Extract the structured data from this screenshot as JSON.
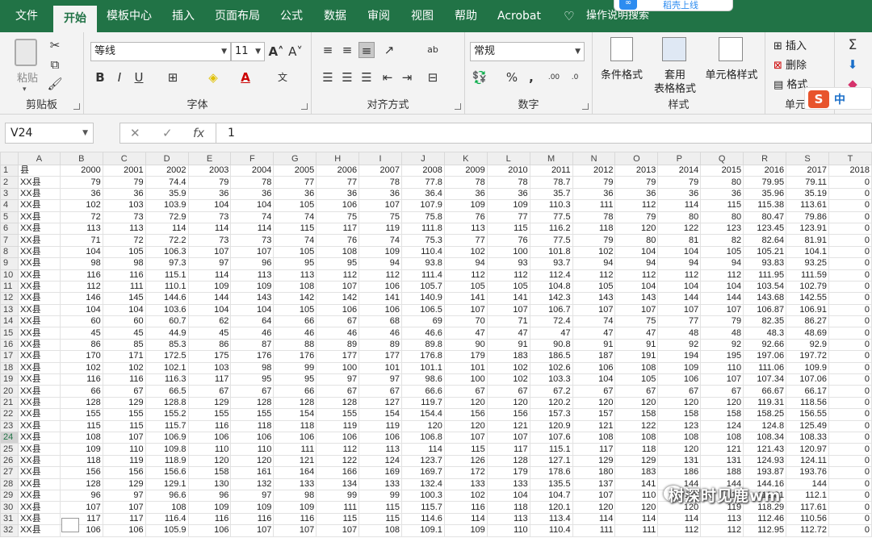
{
  "tabs": [
    {
      "label": "文件",
      "active": false
    },
    {
      "label": "开始",
      "active": true
    },
    {
      "label": "模板中心",
      "active": false
    },
    {
      "label": "插入",
      "active": false
    },
    {
      "label": "页面布局",
      "active": false
    },
    {
      "label": "公式",
      "active": false
    },
    {
      "label": "数据",
      "active": false
    },
    {
      "label": "审阅",
      "active": false
    },
    {
      "label": "视图",
      "active": false
    },
    {
      "label": "帮助",
      "active": false
    },
    {
      "label": "Acrobat",
      "active": false
    }
  ],
  "tell_me": "操作说明搜索",
  "popup_text": "稻壳上线",
  "ribbon": {
    "clipboard": {
      "label": "剪贴板",
      "paste": "粘贴"
    },
    "font": {
      "label": "字体",
      "font_name": "等线",
      "font_size": "11"
    },
    "alignment": {
      "label": "对齐方式"
    },
    "number": {
      "label": "数字",
      "format": "常规"
    },
    "styles": {
      "label": "样式",
      "conditional": "条件格式",
      "table_format": "套用",
      "table_format2": "表格格式",
      "cell_styles": "单元格样式"
    },
    "cells": {
      "label": "单元",
      "insert": "插入",
      "delete": "删除",
      "format": "格式"
    }
  },
  "ime_label": "中",
  "formula_bar": {
    "name_box": "V24",
    "formula": "1"
  },
  "columns": [
    "A",
    "B",
    "C",
    "D",
    "E",
    "F",
    "G",
    "H",
    "I",
    "J",
    "K",
    "L",
    "M",
    "N",
    "O",
    "P",
    "Q",
    "R",
    "S",
    "T"
  ],
  "selected_row": 24,
  "rows": [
    [
      "县",
      "2000",
      "2001",
      "2002",
      "2003",
      "2004",
      "2005",
      "2006",
      "2007",
      "2008",
      "2009",
      "2010",
      "2011",
      "2012",
      "2013",
      "2014",
      "2015",
      "2016",
      "2017",
      "2018"
    ],
    [
      "XX县",
      "79",
      "79",
      "74.4",
      "79",
      "78",
      "77",
      "77",
      "78",
      "77.8",
      "78",
      "78",
      "78.7",
      "79",
      "79",
      "79",
      "80",
      "79.95",
      "79.11",
      "0"
    ],
    [
      "XX县",
      "36",
      "36",
      "35.9",
      "36",
      "36",
      "36",
      "36",
      "36",
      "36.4",
      "36",
      "36",
      "35.7",
      "36",
      "36",
      "36",
      "36",
      "35.96",
      "35.19",
      "0"
    ],
    [
      "XX县",
      "102",
      "103",
      "103.9",
      "104",
      "104",
      "105",
      "106",
      "107",
      "107.9",
      "109",
      "109",
      "110.3",
      "111",
      "112",
      "114",
      "115",
      "115.38",
      "113.61",
      "0"
    ],
    [
      "XX县",
      "72",
      "73",
      "72.9",
      "73",
      "74",
      "74",
      "75",
      "75",
      "75.8",
      "76",
      "77",
      "77.5",
      "78",
      "79",
      "80",
      "80",
      "80.47",
      "79.86",
      "0"
    ],
    [
      "XX县",
      "113",
      "113",
      "114",
      "114",
      "114",
      "115",
      "117",
      "119",
      "111.8",
      "113",
      "115",
      "116.2",
      "118",
      "120",
      "122",
      "123",
      "123.45",
      "123.91",
      "0"
    ],
    [
      "XX县",
      "71",
      "72",
      "72.2",
      "73",
      "73",
      "74",
      "76",
      "74",
      "75.3",
      "77",
      "76",
      "77.5",
      "79",
      "80",
      "81",
      "82",
      "82.64",
      "81.91",
      "0"
    ],
    [
      "XX县",
      "104",
      "105",
      "106.3",
      "107",
      "107",
      "105",
      "108",
      "109",
      "110.4",
      "102",
      "100",
      "101.8",
      "102",
      "104",
      "104",
      "105",
      "105.21",
      "104.1",
      "0"
    ],
    [
      "XX县",
      "98",
      "98",
      "97.3",
      "97",
      "96",
      "95",
      "95",
      "94",
      "93.8",
      "94",
      "93",
      "93.7",
      "94",
      "94",
      "94",
      "94",
      "93.83",
      "93.25",
      "0"
    ],
    [
      "XX县",
      "116",
      "116",
      "115.1",
      "114",
      "113",
      "113",
      "112",
      "112",
      "111.4",
      "112",
      "112",
      "112.4",
      "112",
      "112",
      "112",
      "112",
      "111.95",
      "111.59",
      "0"
    ],
    [
      "XX县",
      "112",
      "111",
      "110.1",
      "109",
      "109",
      "108",
      "107",
      "106",
      "105.7",
      "105",
      "105",
      "104.8",
      "105",
      "104",
      "104",
      "104",
      "103.54",
      "102.79",
      "0"
    ],
    [
      "XX县",
      "146",
      "145",
      "144.6",
      "144",
      "143",
      "142",
      "142",
      "141",
      "140.9",
      "141",
      "141",
      "142.3",
      "143",
      "143",
      "144",
      "144",
      "143.68",
      "142.55",
      "0"
    ],
    [
      "XX县",
      "104",
      "104",
      "103.6",
      "104",
      "104",
      "105",
      "106",
      "106",
      "106.5",
      "107",
      "107",
      "106.7",
      "107",
      "107",
      "107",
      "107",
      "106.87",
      "106.91",
      "0"
    ],
    [
      "XX县",
      "60",
      "60",
      "60.7",
      "62",
      "64",
      "66",
      "67",
      "68",
      "69",
      "70",
      "71",
      "72.4",
      "74",
      "75",
      "77",
      "79",
      "82.35",
      "86.27",
      "0"
    ],
    [
      "XX县",
      "45",
      "45",
      "44.9",
      "45",
      "46",
      "46",
      "46",
      "46",
      "46.6",
      "47",
      "47",
      "47",
      "47",
      "47",
      "48",
      "48",
      "48.3",
      "48.69",
      "0"
    ],
    [
      "XX县",
      "86",
      "85",
      "85.3",
      "86",
      "87",
      "88",
      "89",
      "89",
      "89.8",
      "90",
      "91",
      "90.8",
      "91",
      "91",
      "92",
      "92",
      "92.66",
      "92.9",
      "0"
    ],
    [
      "XX县",
      "170",
      "171",
      "172.5",
      "175",
      "176",
      "176",
      "177",
      "177",
      "176.8",
      "179",
      "183",
      "186.5",
      "187",
      "191",
      "194",
      "195",
      "197.06",
      "197.72",
      "0"
    ],
    [
      "XX县",
      "102",
      "102",
      "102.1",
      "103",
      "98",
      "99",
      "100",
      "101",
      "101.1",
      "101",
      "102",
      "102.6",
      "106",
      "108",
      "109",
      "110",
      "111.06",
      "109.9",
      "0"
    ],
    [
      "XX县",
      "116",
      "116",
      "116.3",
      "117",
      "95",
      "95",
      "97",
      "97",
      "98.6",
      "100",
      "102",
      "103.3",
      "104",
      "105",
      "106",
      "107",
      "107.34",
      "107.06",
      "0"
    ],
    [
      "XX县",
      "66",
      "67",
      "66.5",
      "67",
      "67",
      "66",
      "67",
      "67",
      "66.6",
      "67",
      "67",
      "67.2",
      "67",
      "67",
      "67",
      "67",
      "66.67",
      "66.17",
      "0"
    ],
    [
      "XX县",
      "128",
      "129",
      "128.8",
      "129",
      "128",
      "128",
      "128",
      "127",
      "119.7",
      "120",
      "120",
      "120.2",
      "120",
      "120",
      "120",
      "120",
      "119.31",
      "118.56",
      "0"
    ],
    [
      "XX县",
      "155",
      "155",
      "155.2",
      "155",
      "155",
      "154",
      "155",
      "154",
      "154.4",
      "156",
      "156",
      "157.3",
      "157",
      "158",
      "158",
      "158",
      "158.25",
      "156.55",
      "0"
    ],
    [
      "XX县",
      "115",
      "115",
      "115.7",
      "116",
      "118",
      "118",
      "119",
      "119",
      "120",
      "120",
      "121",
      "120.9",
      "121",
      "122",
      "123",
      "124",
      "124.8",
      "125.49",
      "0"
    ],
    [
      "XX县",
      "108",
      "107",
      "106.9",
      "106",
      "106",
      "106",
      "106",
      "106",
      "106.8",
      "107",
      "107",
      "107.6",
      "108",
      "108",
      "108",
      "108",
      "108.34",
      "108.33",
      "0"
    ],
    [
      "XX县",
      "109",
      "110",
      "109.8",
      "110",
      "110",
      "111",
      "112",
      "113",
      "114",
      "115",
      "117",
      "115.1",
      "117",
      "118",
      "120",
      "121",
      "121.43",
      "120.97",
      "0"
    ],
    [
      "XX县",
      "118",
      "119",
      "118.9",
      "120",
      "120",
      "121",
      "122",
      "124",
      "123.7",
      "126",
      "128",
      "127.1",
      "129",
      "129",
      "131",
      "131",
      "124.93",
      "124.11",
      "0"
    ],
    [
      "XX县",
      "156",
      "156",
      "156.6",
      "158",
      "161",
      "164",
      "166",
      "169",
      "169.7",
      "172",
      "179",
      "178.6",
      "180",
      "183",
      "186",
      "188",
      "193.87",
      "193.76",
      "0"
    ],
    [
      "XX县",
      "128",
      "129",
      "129.1",
      "130",
      "132",
      "133",
      "134",
      "133",
      "132.4",
      "133",
      "133",
      "135.5",
      "137",
      "141",
      "144",
      "144",
      "144.16",
      "144",
      "0"
    ],
    [
      "XX县",
      "96",
      "97",
      "96.6",
      "96",
      "97",
      "98",
      "99",
      "99",
      "100.3",
      "102",
      "104",
      "104.7",
      "107",
      "110",
      "112",
      "113",
      "112.31",
      "112.1",
      "0"
    ],
    [
      "XX县",
      "107",
      "107",
      "108",
      "109",
      "109",
      "109",
      "111",
      "115",
      "115.7",
      "116",
      "118",
      "120.1",
      "120",
      "120",
      "120",
      "119",
      "118.29",
      "117.61",
      "0"
    ],
    [
      "XX县",
      "117",
      "117",
      "116.4",
      "116",
      "116",
      "116",
      "115",
      "115",
      "114.6",
      "114",
      "113",
      "113.4",
      "114",
      "114",
      "114",
      "113",
      "112.46",
      "110.56",
      "0"
    ],
    [
      "XX县",
      "106",
      "106",
      "105.9",
      "106",
      "107",
      "107",
      "107",
      "108",
      "109.1",
      "109",
      "110",
      "110.4",
      "111",
      "111",
      "112",
      "112",
      "112.95",
      "112.72",
      "0"
    ]
  ],
  "watermark": "树深时见鹿wm"
}
